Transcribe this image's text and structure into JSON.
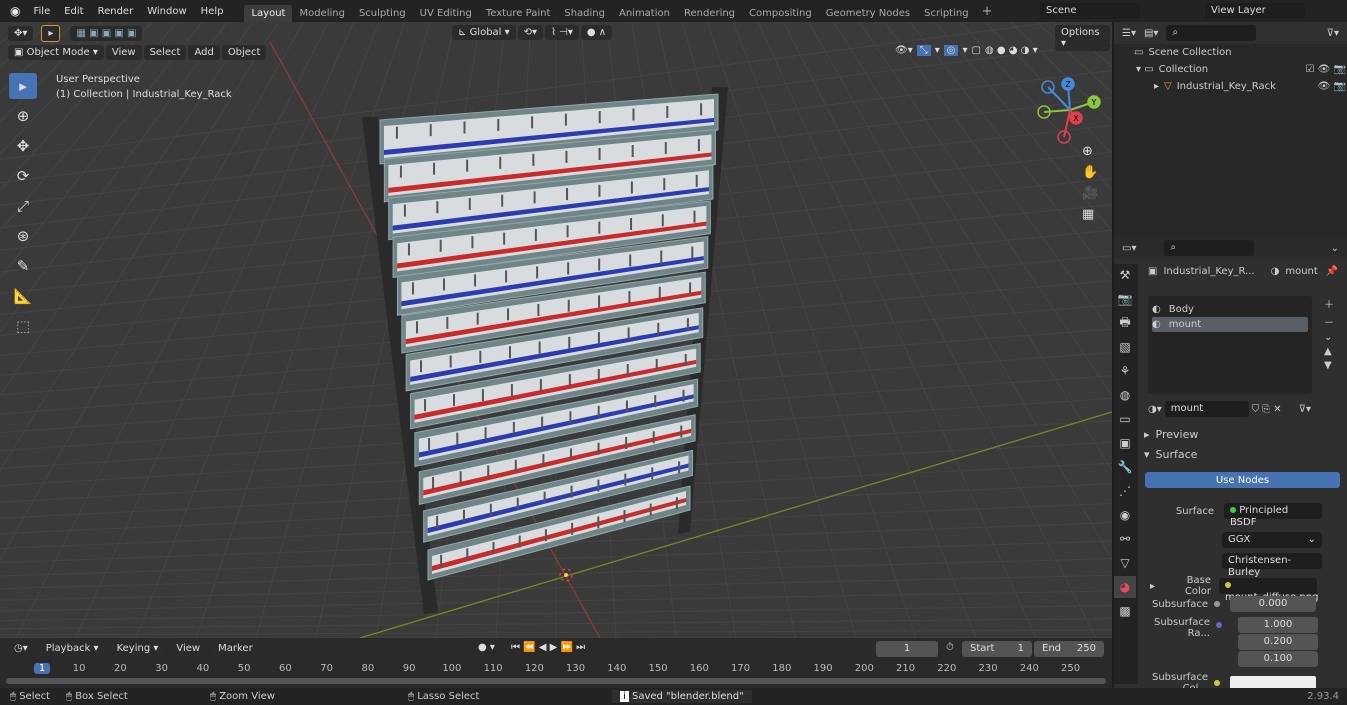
{
  "menus": [
    "File",
    "Edit",
    "Render",
    "Window",
    "Help"
  ],
  "workspaces": [
    "Layout",
    "Modeling",
    "Sculpting",
    "UV Editing",
    "Texture Paint",
    "Shading",
    "Animation",
    "Rendering",
    "Compositing",
    "Geometry Nodes",
    "Scripting"
  ],
  "active_workspace": "Layout",
  "scene": "Scene",
  "view_layer": "View Layer",
  "viewport": {
    "mode": "Object Mode",
    "menus": [
      "View",
      "Select",
      "Add",
      "Object"
    ],
    "orientation": "Global",
    "options": "Options",
    "info_line1": "User Perspective",
    "info_line2": "(1) Collection | Industrial_Key_Rack",
    "gizmo": {
      "x": "X",
      "y": "Y",
      "z": "Z"
    },
    "rack_stripe_colors": [
      "#2a3cb0",
      "#c92a2a"
    ]
  },
  "outliner": {
    "root": "Scene Collection",
    "collection": "Collection",
    "object": "Industrial_Key_Rack"
  },
  "properties": {
    "object": "Industrial_Key_R...",
    "material": "mount",
    "slots": [
      "Body",
      "mount"
    ],
    "active_slot": "mount",
    "material_name": "mount",
    "preview": "Preview",
    "surface_panel": "Surface",
    "use_nodes": "Use Nodes",
    "surface_label": "Surface",
    "surface_value": "Principled BSDF",
    "distribution": "GGX",
    "subsurface_method": "Christensen-Burley",
    "base_color_label": "Base Color",
    "base_color_value": "mount_diffuse.png",
    "subsurface_label": "Subsurface",
    "subsurface_value": "0.000",
    "subsurface_radius_label": "Subsurface Ra...",
    "subsurface_radius": [
      "1.000",
      "0.200",
      "0.100"
    ],
    "subsurface_color_label": "Subsurface Col..."
  },
  "timeline": {
    "menus": [
      "Playback",
      "Keying",
      "View",
      "Marker"
    ],
    "current_frame": "1",
    "start_label": "Start",
    "start": "1",
    "end_label": "End",
    "end": "250",
    "ticks": [
      "1",
      "10",
      "20",
      "30",
      "40",
      "50",
      "60",
      "70",
      "80",
      "90",
      "100",
      "110",
      "120",
      "130",
      "140",
      "150",
      "160",
      "170",
      "180",
      "190",
      "200",
      "210",
      "220",
      "230",
      "240",
      "250"
    ]
  },
  "status": {
    "select": "Select",
    "box_select": "Box Select",
    "zoom_view": "Zoom View",
    "lasso_select": "Lasso Select",
    "message": "Saved \"blender.blend\"",
    "version": "2.93.4"
  }
}
